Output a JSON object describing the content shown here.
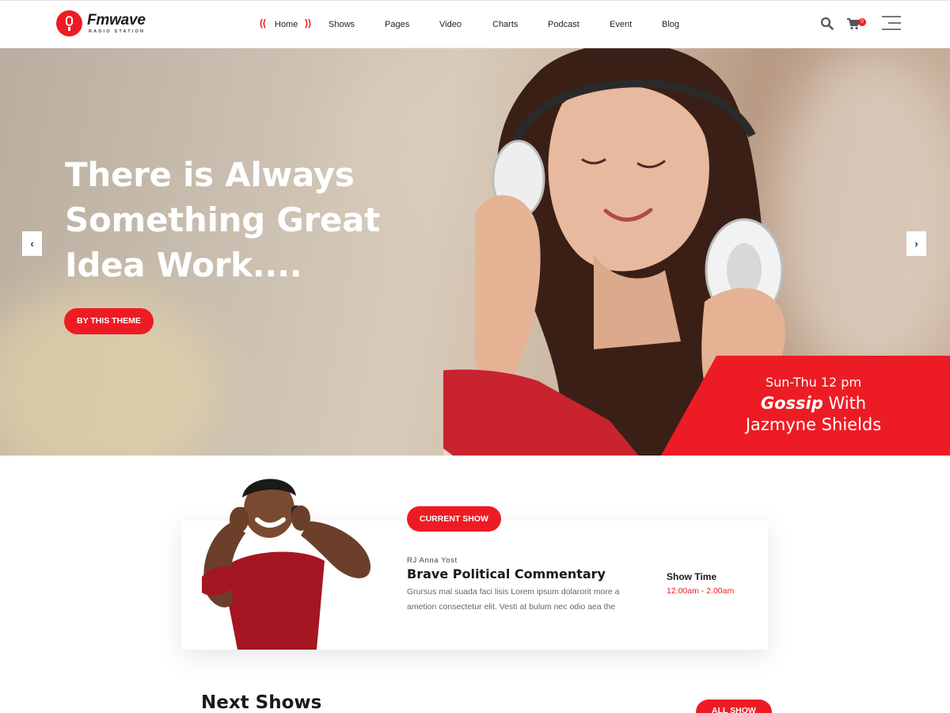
{
  "brand": {
    "name": "Fmwave",
    "tagline": "RADIO STATION",
    "accent": "#ed1c24"
  },
  "nav": {
    "items": [
      {
        "label": "Home",
        "active": true
      },
      {
        "label": "Shows"
      },
      {
        "label": "Pages"
      },
      {
        "label": "Video"
      },
      {
        "label": "Charts"
      },
      {
        "label": "Podcast"
      },
      {
        "label": "Event"
      },
      {
        "label": "Blog"
      }
    ],
    "cart_count": "0",
    "icons": [
      "search-icon",
      "cart-icon",
      "menu-icon"
    ]
  },
  "hero": {
    "title_line1": "There is Always",
    "title_line2": "Something Great",
    "title_line3": "Idea Work....",
    "cta_label": "BY THIS THEME",
    "prev_icon": "‹",
    "next_icon": "›",
    "promo": {
      "time": "Sun-Thu 12 pm",
      "title_bold": "Gossip",
      "title_rest": " With",
      "host": "Jazmyne Shields"
    }
  },
  "current_show": {
    "badge": "CURRENT SHOW",
    "rj": "RJ Anna Yost",
    "title": "Brave Political Commentary",
    "desc_line1": "Grursus mal suada faci lisis Lorem ipsum dolarorit more a",
    "desc_line2": "ametion consectetur elit. Vesti at bulum nec odio aea the",
    "showtime_label": "Show Time",
    "showtime_value": "12.00am - 2.00am"
  },
  "next_shows": {
    "title": "Next Shows",
    "all_label": "ALL SHOW"
  }
}
